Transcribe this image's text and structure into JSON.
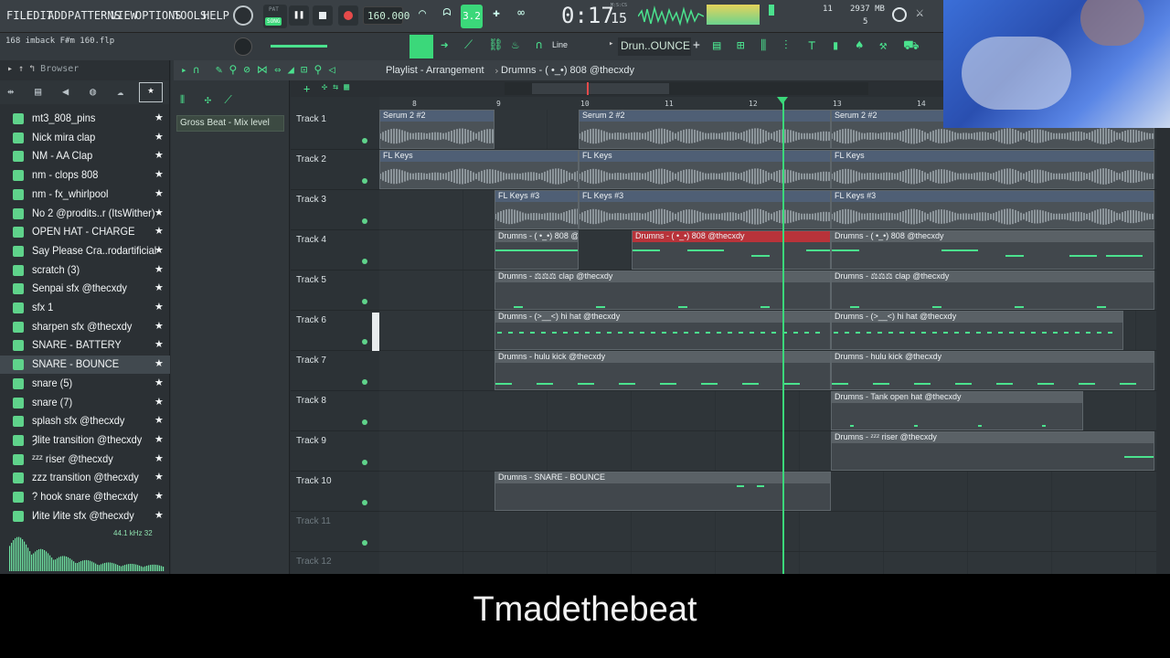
{
  "menu": [
    "FILE",
    "EDIT",
    "ADD",
    "PATTERNS",
    "VIEW",
    "OPTIONS",
    "TOOLS",
    "HELP"
  ],
  "transport": {
    "pat_label": "PAT",
    "song_label": "SONG",
    "tempo": "160.000",
    "time": "0:17",
    "time_sub": "15",
    "time_unit": "M:S:CS",
    "cpu_label": "11",
    "memory": "2937 MB",
    "voices": "5"
  },
  "project_name": "168 imback F#m 160.flp",
  "snap_mode": "Line",
  "pattern_selector": "Drun..OUNCE",
  "browser": {
    "title": "Browser",
    "items": [
      {
        "label": "mt3_808_pins"
      },
      {
        "label": "Nick mira clap"
      },
      {
        "label": "NM - AA Clap"
      },
      {
        "label": "nm - clops 808"
      },
      {
        "label": "nm - fx_whirlpool"
      },
      {
        "label": "No 2 @prodits..r (ItsWither)"
      },
      {
        "label": "OPEN HAT - CHARGE"
      },
      {
        "label": "Say Please Cra..rodartificial"
      },
      {
        "label": "scratch (3)"
      },
      {
        "label": "Senpai sfx @thecxdy"
      },
      {
        "label": "sfx 1"
      },
      {
        "label": "sharpen sfx @thecxdy"
      },
      {
        "label": "SNARE - BATTERY"
      },
      {
        "label": "SNARE - BOUNCE"
      },
      {
        "label": "snare (5)"
      },
      {
        "label": "snare (7)"
      },
      {
        "label": "splash sfx @thecxdy"
      },
      {
        "label": "Ȝlite transition @thecxdy"
      },
      {
        "label": "ᶻᶻᶻ riser @thecxdy"
      },
      {
        "label": "zzz transition @thecxdy"
      },
      {
        "label": "? hook snare @thecxdy"
      },
      {
        "label": "Иite Иite sfx @thecxdy"
      }
    ],
    "selected_index": 13,
    "sample_info": "44.1 kHz 32"
  },
  "picker": {
    "pattern": "Gross Beat - Mix level"
  },
  "playlist": {
    "title": "Playlist - Arrangement",
    "breadcrumb": "Drumns - ( •_•) 808 @thecxdy",
    "bars": [
      "8",
      "9",
      "10",
      "11",
      "12",
      "13",
      "14"
    ],
    "tracks": [
      "Track 1",
      "Track 2",
      "Track 3",
      "Track 4",
      "Track 5",
      "Track 6",
      "Track 7",
      "Track 8",
      "Track 9",
      "Track 10",
      "Track 11",
      "Track 12"
    ],
    "clips": {
      "serum": "Serum 2 #2",
      "keys": "FL Keys",
      "keys3": "FL Keys #3",
      "t4a": "Drumns - ( •_•) 808 @thecxdy",
      "t4b": "Drumns - ( •_•) 808 @thecxdy",
      "t5": "Drumns - ⚖⚖⚖ clap @thecxdy",
      "t6": "Drumns - (>__<) hi hat @thecxdy",
      "t7": "Drumns - hulu kick @thecxdy",
      "t8": "Drumns - Tank open hat @thecxdy",
      "t9": "Drumns - ᶻᶻᶻ riser @thecxdy",
      "t10": "Drumns - SNARE - BOUNCE"
    }
  },
  "subtitle": "Tmadethebeat",
  "colors": {
    "accent": "#4be28e",
    "clip_red": "#b8333a"
  }
}
